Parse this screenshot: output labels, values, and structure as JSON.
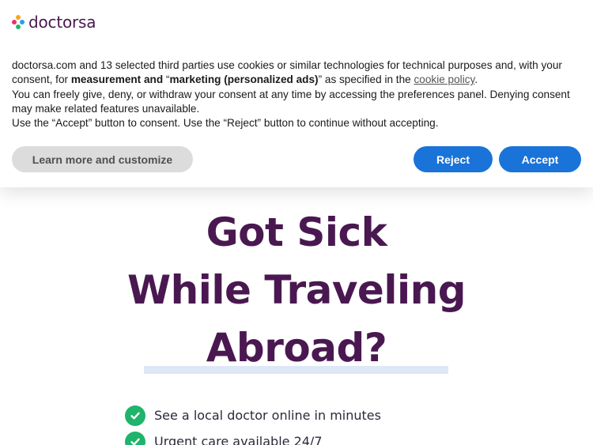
{
  "brand": {
    "name": "doctorsa",
    "dot_colors": [
      "#f5a623",
      "#e8336d",
      "#2e9bf0",
      "#22b573"
    ]
  },
  "hero": {
    "title_lines": [
      "Got Sick",
      "While Traveling",
      "Abroad?"
    ],
    "title_color": "#4a1850",
    "underline_color": "#dde7f6"
  },
  "features": [
    {
      "icon": "check-circle-icon",
      "text": "See a local doctor online in minutes"
    },
    {
      "icon": "check-circle-icon",
      "text": "Urgent care available 24/7"
    }
  ],
  "cookie_banner": {
    "paragraph1": {
      "part1": "doctorsa.com and 13 selected third parties use cookies or similar technologies for technical purposes and, with your consent, for ",
      "bold1": "measurement and",
      "part2": " “",
      "bold2": "marketing (personalized ads)",
      "part3": "” as specified in the ",
      "link": "cookie policy",
      "part4": "."
    },
    "paragraph2": "You can freely give, deny, or withdraw your consent at any time by accessing the preferences panel. Denying consent may make related features unavailable.",
    "paragraph3": "Use the “Accept” button to consent. Use the “Reject” button to continue without accepting.",
    "buttons": {
      "learn_more": "Learn more and customize",
      "reject": "Reject",
      "accept": "Accept"
    },
    "accent_color": "#1a73d9"
  }
}
